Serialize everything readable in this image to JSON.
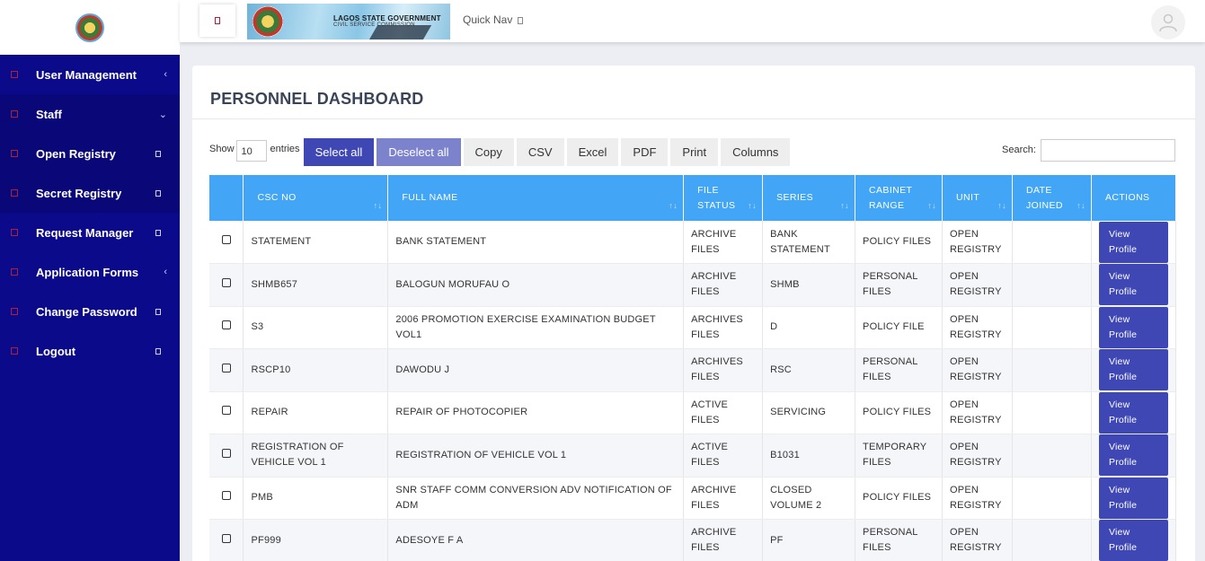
{
  "sidebar": {
    "items": [
      {
        "label": "User Management",
        "indicator": "‹"
      },
      {
        "label": "Staff",
        "indicator": "⌄"
      },
      {
        "label": "Open Registry",
        "indicator": "square"
      },
      {
        "label": "Secret Registry",
        "indicator": "square"
      },
      {
        "label": "Request Manager",
        "indicator": "square"
      },
      {
        "label": "Application Forms",
        "indicator": "‹"
      },
      {
        "label": "Change Password",
        "indicator": "square"
      },
      {
        "label": "Logout",
        "indicator": "square"
      }
    ]
  },
  "topbar": {
    "banner_title": "LAGOS STATE GOVERNMENT",
    "banner_subtitle": "CIVIL SERVICE COMMISSION",
    "quick_nav": "Quick Nav"
  },
  "page": {
    "title": "PERSONNEL DASHBOARD"
  },
  "controls": {
    "show_label": "Show",
    "entries_value": "10",
    "entries_label": "entries",
    "select_all": "Select all",
    "deselect_all": "Deselect all",
    "copy": "Copy",
    "csv": "CSV",
    "excel": "Excel",
    "pdf": "PDF",
    "print": "Print",
    "columns": "Columns",
    "search_label": "Search:"
  },
  "table": {
    "headers": [
      "CSC NO",
      "FULL NAME",
      "FILE STATUS",
      "SERIES",
      "CABINET RANGE",
      "UNIT",
      "DATE JOINED",
      "ACTIONS"
    ],
    "action_label": "View Profile",
    "rows": [
      {
        "csc": "STATEMENT",
        "name": "BANK STATEMENT",
        "status": "ARCHIVE FILES",
        "series": "BANK STATEMENT",
        "cabinet": "POLICY FILES",
        "unit": "OPEN REGISTRY",
        "date": ""
      },
      {
        "csc": "SHMB657",
        "name": "BALOGUN MORUFAU O",
        "status": "ARCHIVE FILES",
        "series": "SHMB",
        "cabinet": "PERSONAL FILES",
        "unit": "OPEN REGISTRY",
        "date": ""
      },
      {
        "csc": "S3",
        "name": "2006 PROMOTION EXERCISE EXAMINATION BUDGET VOL1",
        "status": "ARCHIVES FILES",
        "series": "D",
        "cabinet": "POLICY FILE",
        "unit": "OPEN REGISTRY",
        "date": ""
      },
      {
        "csc": "RSCP10",
        "name": "DAWODU J",
        "status": "ARCHIVES FILES",
        "series": "RSC",
        "cabinet": "PERSONAL FILES",
        "unit": "OPEN REGISTRY",
        "date": ""
      },
      {
        "csc": "REPAIR",
        "name": "REPAIR OF PHOTOCOPIER",
        "status": "ACTIVE FILES",
        "series": "SERVICING",
        "cabinet": "POLICY FILES",
        "unit": "OPEN REGISTRY",
        "date": ""
      },
      {
        "csc": "REGISTRATION OF VEHICLE VOL 1",
        "name": "REGISTRATION OF VEHICLE VOL 1",
        "status": "ACTIVE FILES",
        "series": "B1031",
        "cabinet": "TEMPORARY FILES",
        "unit": "OPEN REGISTRY",
        "date": ""
      },
      {
        "csc": "PMB",
        "name": "SNR STAFF COMM CONVERSION ADV NOTIFICATION OF ADM",
        "status": "ARCHIVE FILES",
        "series": "CLOSED VOLUME 2",
        "cabinet": "POLICY FILES",
        "unit": "OPEN REGISTRY",
        "date": ""
      },
      {
        "csc": "PF999",
        "name": "ADESOYE F A",
        "status": "ARCHIVE FILES",
        "series": "PF",
        "cabinet": "PERSONAL FILES",
        "unit": "OPEN REGISTRY",
        "date": ""
      }
    ]
  },
  "colors": {
    "sidebar_bg": "#0b0a8a",
    "table_header": "#42a5f5",
    "primary_button": "#3f47b4"
  }
}
